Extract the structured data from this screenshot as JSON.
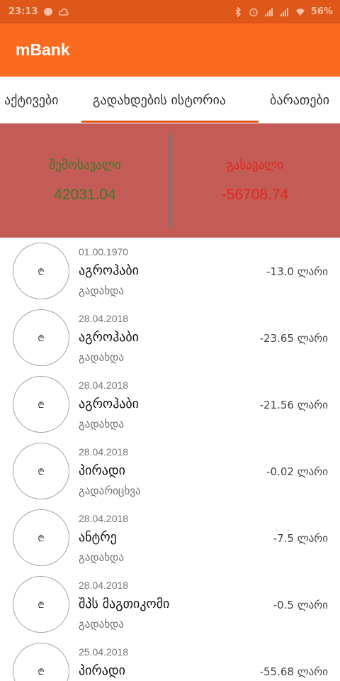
{
  "status_bar": {
    "time": "23:13",
    "battery": "56%",
    "color": "#e0571a"
  },
  "app_bar": {
    "title": "mBank",
    "color": "#fb6b1f"
  },
  "tabs": [
    {
      "label": "აქტივები",
      "active": false
    },
    {
      "label": "გადახდების ისტორია",
      "active": true
    },
    {
      "label": "ბარათები",
      "active": false
    }
  ],
  "summary": {
    "income_label": "შემოსავალი",
    "income_value": "42031.04",
    "income_color": "#3b7a2a",
    "expense_label": "გასავალი",
    "expense_value": "-56708.74",
    "expense_color": "#e8231d",
    "background": "#c35c56"
  },
  "transactions": [
    {
      "icon": "lari-icon",
      "icon_glyph": "₾",
      "date": "01.00.1970",
      "name": "აგროჰაბი",
      "type": "გადახდა",
      "amount": "-13.0 ლარი"
    },
    {
      "icon": "lari-icon",
      "icon_glyph": "₾",
      "date": "28.04.2018",
      "name": "აგროჰაბი",
      "type": "გადახდა",
      "amount": "-23.65 ლარი"
    },
    {
      "icon": "lari-icon",
      "icon_glyph": "₾",
      "date": "28.04.2018",
      "name": "აგროჰაბი",
      "type": "გადახდა",
      "amount": "-21.56 ლარი"
    },
    {
      "icon": "lari-icon",
      "icon_glyph": "₾",
      "date": "28.04.2018",
      "name": "პირადი",
      "type": "გადარიცხვა",
      "amount": "-0.02 ლარი"
    },
    {
      "icon": "lari-icon",
      "icon_glyph": "₾",
      "date": "28.04.2018",
      "name": "ანტრე",
      "type": "გადახდა",
      "amount": "-7.5 ლარი"
    },
    {
      "icon": "lari-icon",
      "icon_glyph": "₾",
      "date": "28.04.2018",
      "name": "შპს მაგთიკომი",
      "type": "გადახდა",
      "amount": "-0.5 ლარი"
    },
    {
      "icon": "lari-icon",
      "icon_glyph": "₾",
      "date": "25.04.2018",
      "name": "პირადი",
      "type": "",
      "amount": "-55.68 ლარი"
    }
  ]
}
